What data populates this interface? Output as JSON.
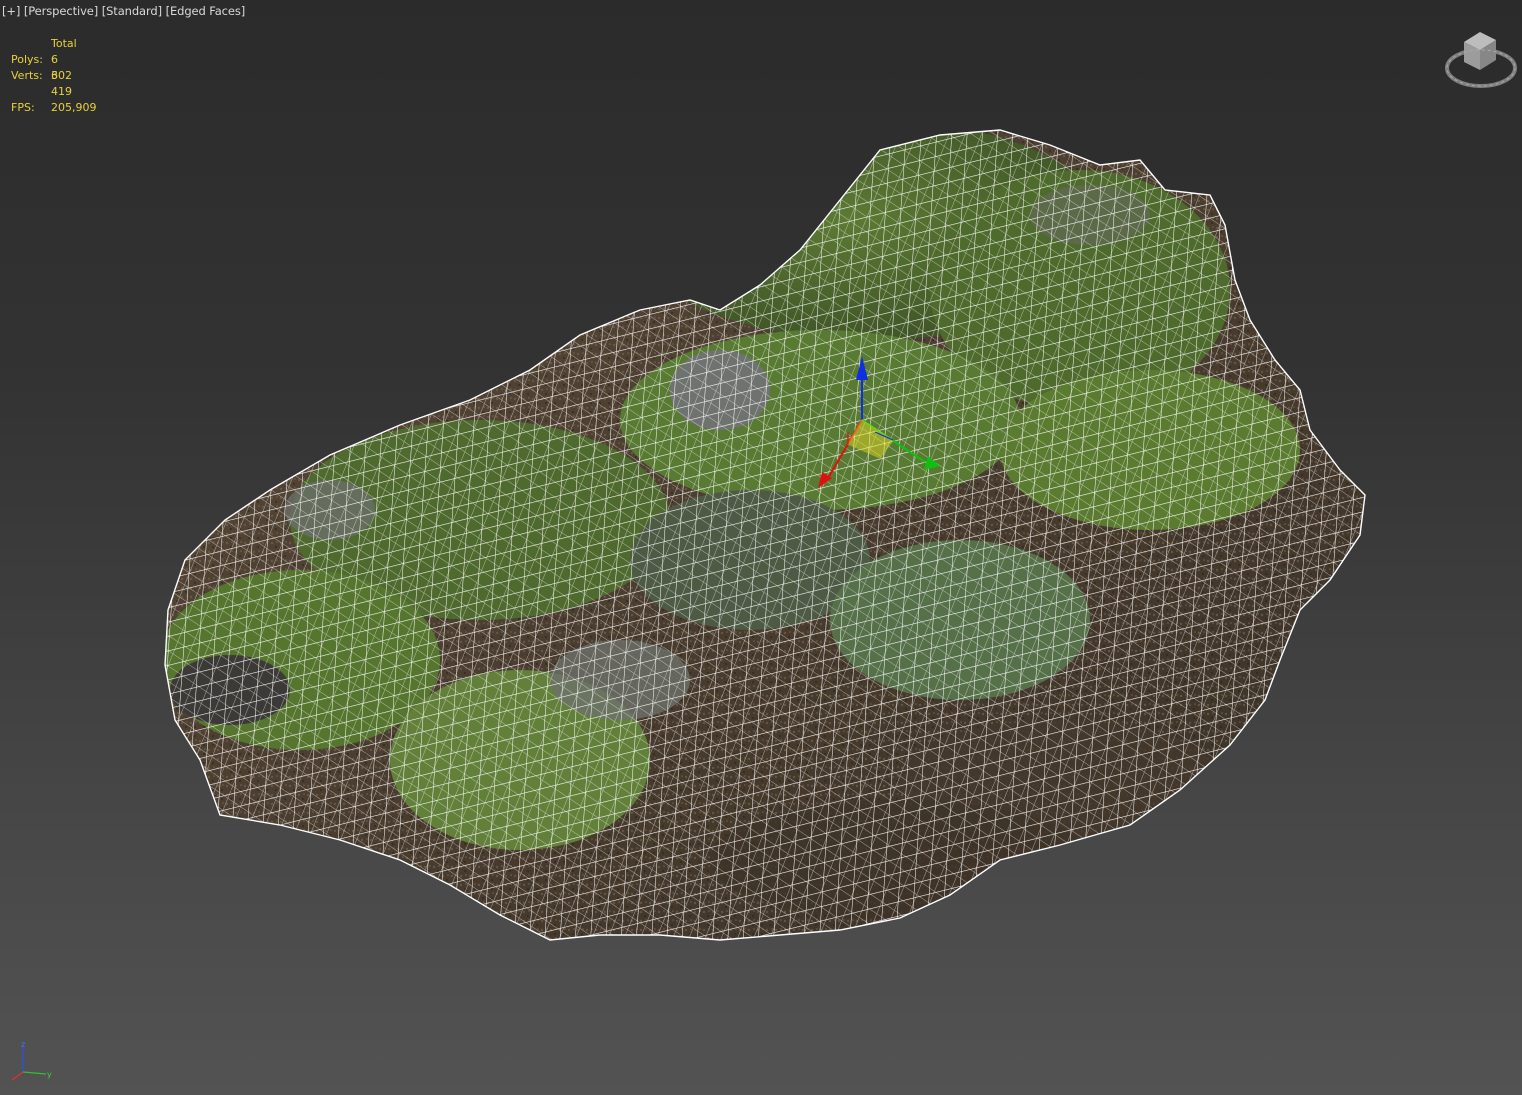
{
  "viewport": {
    "label_plus": "[+]",
    "label_view": "[Perspective]",
    "label_shading": "[Standard]",
    "label_mode": "[Edged Faces]"
  },
  "stats": {
    "header": "Total",
    "polys_label": "Polys:",
    "polys_value": "6 302",
    "verts_label": "Verts:",
    "verts_value": "6 419",
    "fps_label": "FPS:",
    "fps_value": "205,909"
  },
  "viewcube": {
    "icon": "viewcube-icon"
  },
  "gizmo": {
    "icon": "move-gizmo-icon",
    "axes": [
      "x",
      "y",
      "z"
    ]
  },
  "world_axis": {
    "icon": "world-axis-tripod-icon",
    "labels": [
      "z",
      "x",
      "y"
    ]
  },
  "mesh": {
    "name": "rock-scan-mesh",
    "wire_color": "#ffffff"
  },
  "colors": {
    "stats_text": "#e8d23a",
    "label_text": "#d8d8d8",
    "axis_x": "#e01010",
    "axis_y": "#10c010",
    "axis_z": "#1030e0",
    "plane_highlight": "#f0e020"
  }
}
